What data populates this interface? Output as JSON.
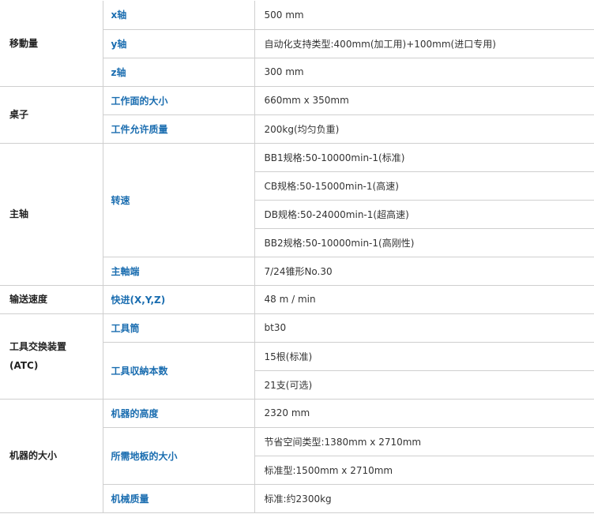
{
  "spec_table": {
    "movement": {
      "category": "移動量",
      "x_label": "x轴",
      "x_value": "500 mm",
      "y_label": "y轴",
      "y_value": "自动化支持类型:400mm(加工用)+100mm(进口专用)",
      "z_label": "z轴",
      "z_value": "300 mm"
    },
    "table": {
      "category": "桌子",
      "size_label": "工作面的大小",
      "size_value": "660mm x 350mm",
      "load_label": "工件允许质量",
      "load_value": "200kg(均匀负重)"
    },
    "spindle": {
      "category": "主轴",
      "speed_label": "转速",
      "speed_values": [
        "BB1规格:50-10000min-1(标准)",
        "CB规格:50-15000min-1(高速)",
        "DB规格:50-24000min-1(超高速)",
        "BB2规格:50-10000min-1(高刚性)"
      ],
      "end_label": "主軸端",
      "end_value": "7/24锥形No.30"
    },
    "feed": {
      "category": "输送速度",
      "rapid_label": "快进(X,Y,Z)",
      "rapid_value": "48 m / min"
    },
    "atc": {
      "category_line1": "工具交换装置",
      "category_line2": "(ATC)",
      "shank_label": "工具筒",
      "shank_value": "bt30",
      "capacity_label": "工具収納本数",
      "capacity_values": [
        "15根(标准)",
        "21支(可选)"
      ]
    },
    "machine": {
      "category": "机器的大小",
      "height_label": "机器的高度",
      "height_value": "2320 mm",
      "floor_label": "所需地板的大小",
      "floor_values": [
        "节省空间类型:1380mm x 2710mm",
        "标准型:1500mm x 2710mm"
      ],
      "mass_label": "机械质量",
      "mass_value": "标准:约2300kg"
    }
  }
}
